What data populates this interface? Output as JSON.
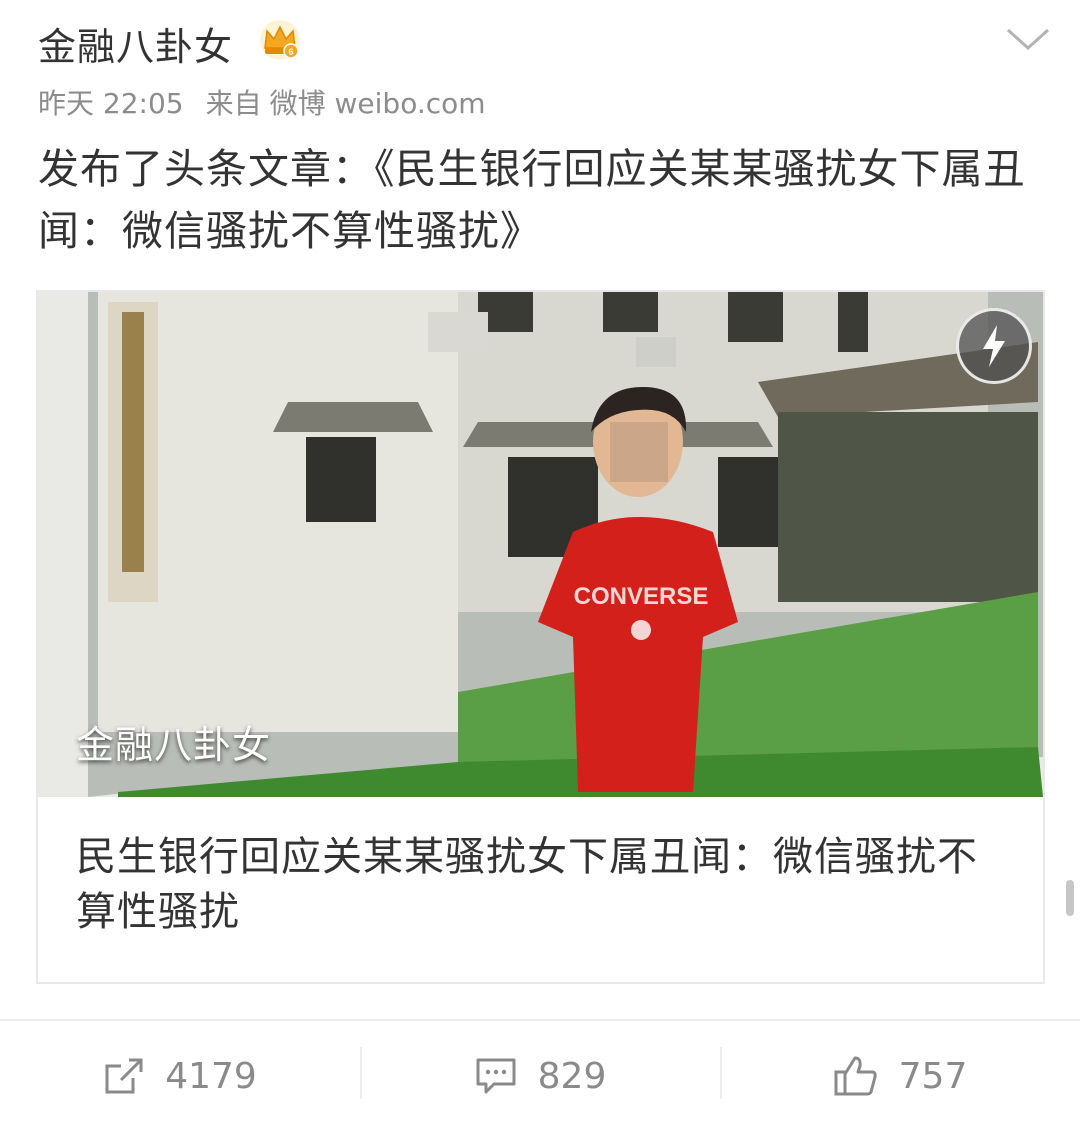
{
  "post": {
    "username": "金融八卦女",
    "time": "昨天 22:05",
    "source_label": "来自",
    "source_app": "微博 weibo.com",
    "text": "发布了头条文章：《民生银行回应关某某骚扰女下属丑闻：微信骚扰不算性骚扰》"
  },
  "card": {
    "image_watermark": "金融八卦女",
    "shirt_text": "CONVERSE",
    "title": "民生银行回应关某某骚扰女下属丑闻：微信骚扰不算性骚扰"
  },
  "actions": {
    "repost_count": "4179",
    "comment_count": "829",
    "like_count": "757"
  },
  "colors": {
    "text": "#333333",
    "meta": "#8c8c8c",
    "action": "#8a8a8a",
    "crown": "#f5a623"
  },
  "icons": [
    "crown-icon",
    "chevron-down-icon",
    "flash-icon",
    "repost-icon",
    "comment-icon",
    "like-icon"
  ]
}
